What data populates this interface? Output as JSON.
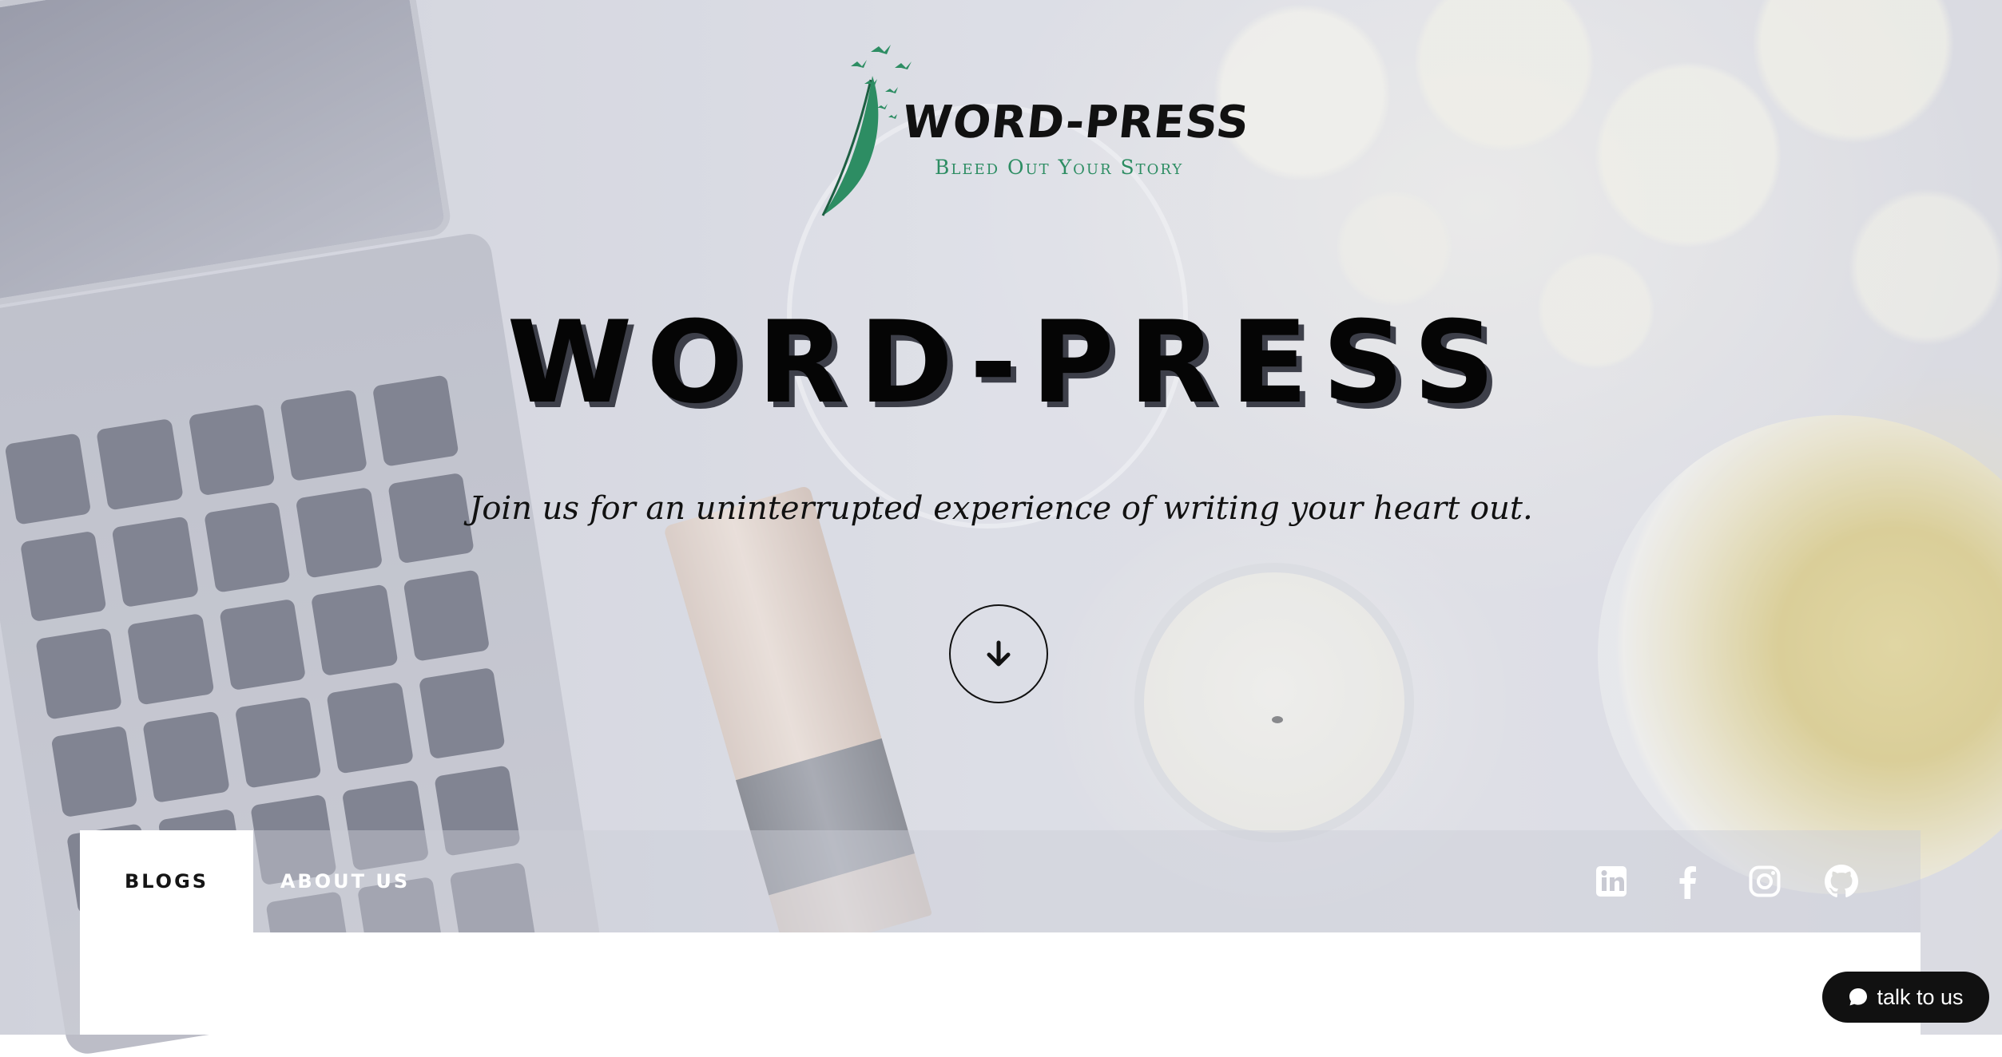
{
  "logo": {
    "title": "WORD-PRESS",
    "tagline": "Bleed Out Your Story",
    "accent_color": "#2d8d63"
  },
  "hero": {
    "headline": "WORD-PRESS",
    "subheadline": "Join us for an uninterrupted experience of writing your heart out.",
    "scroll_icon": "arrow-down-icon"
  },
  "nav": {
    "tabs": [
      {
        "label": "BLOGS",
        "active": true
      },
      {
        "label": "ABOUT US",
        "active": false
      }
    ],
    "social": [
      {
        "name": "linkedin-icon"
      },
      {
        "name": "facebook-icon"
      },
      {
        "name": "instagram-icon"
      },
      {
        "name": "github-icon"
      }
    ]
  },
  "chat": {
    "label": "talk to us",
    "icon": "chat-bubble-icon"
  }
}
